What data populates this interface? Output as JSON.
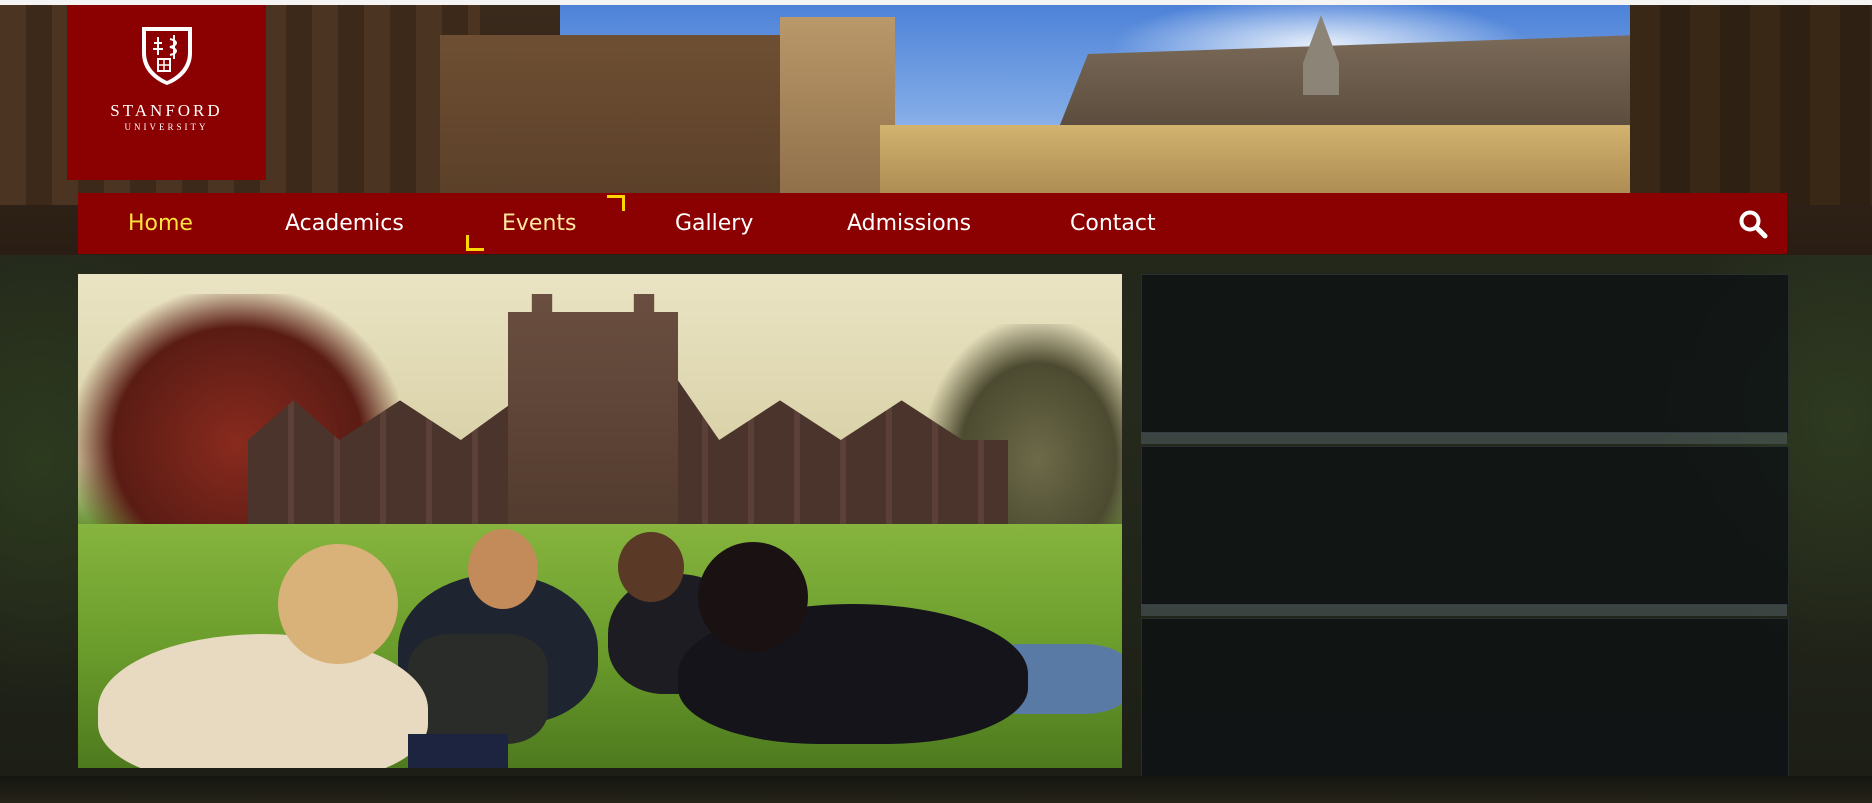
{
  "logo": {
    "name": "STANFORD",
    "sub": "UNIVERSITY",
    "icon": "shield-icon",
    "color": "#8b0000"
  },
  "nav": {
    "items": [
      {
        "label": "Home",
        "active": true
      },
      {
        "label": "Academics",
        "active": false
      },
      {
        "label": "Events",
        "active": false
      },
      {
        "label": "Gallery",
        "active": false
      },
      {
        "label": "Admissions",
        "active": false
      },
      {
        "label": "Contact",
        "active": false
      }
    ],
    "search_icon": "search-icon",
    "hover_item": "Events",
    "background": "#8b0000",
    "active_color": "#ffe23f",
    "bracket_color": "#ffd700"
  },
  "hero": {
    "image": "students-on-campus-lawn"
  },
  "side_panels": {
    "count": 3,
    "background": "#0e1214"
  }
}
